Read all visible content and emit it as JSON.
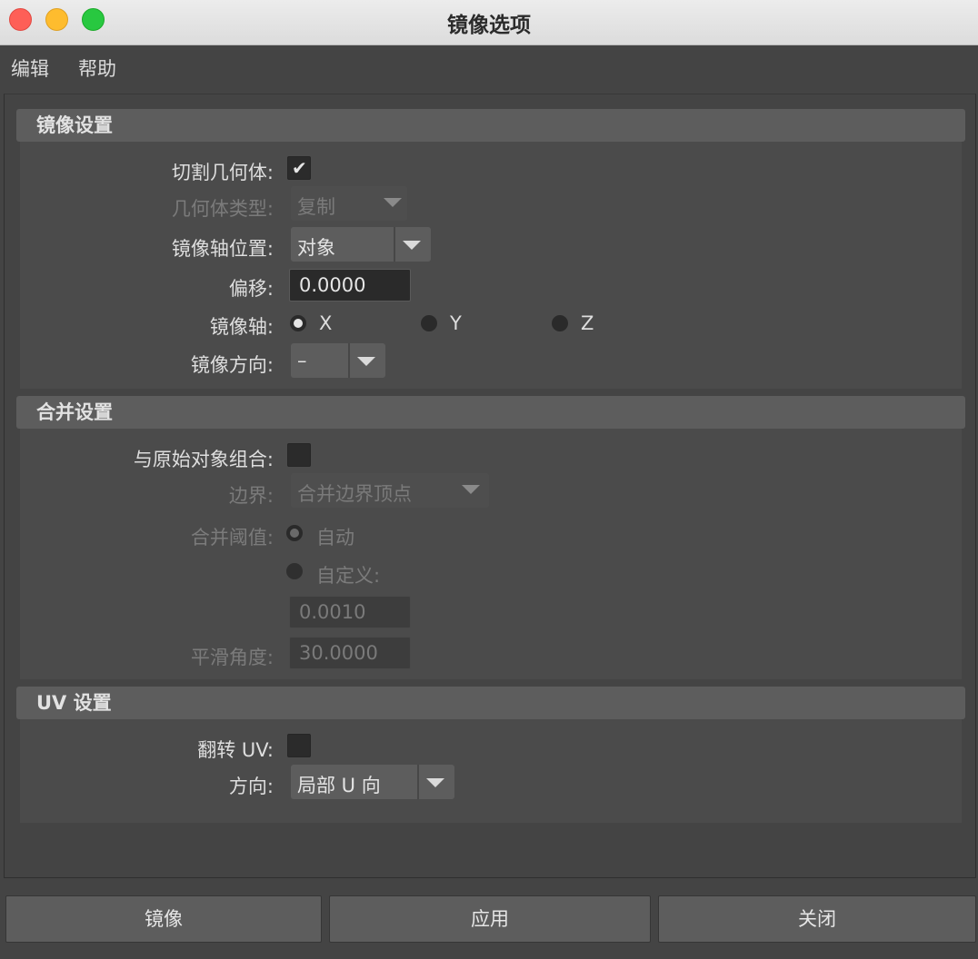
{
  "window": {
    "title": "镜像选项"
  },
  "menu": {
    "items": [
      "编辑",
      "帮助"
    ]
  },
  "sections": {
    "mirror": {
      "title": "镜像设置",
      "cut_geometry_label": "切割几何体:",
      "cut_geometry_checked": true,
      "geometry_type_label": "几何体类型:",
      "geometry_type_value": "复制",
      "axis_position_label": "镜像轴位置:",
      "axis_position_value": "对象",
      "offset_label": "偏移:",
      "offset_value": "0.0000",
      "axis_label": "镜像轴:",
      "axis_options": [
        "X",
        "Y",
        "Z"
      ],
      "axis_selected": "X",
      "direction_label": "镜像方向:",
      "direction_value": "–"
    },
    "merge": {
      "title": "合并设置",
      "combine_label": "与原始对象组合:",
      "combine_checked": false,
      "border_label": "边界:",
      "border_value": "合并边界顶点",
      "threshold_label": "合并阈值:",
      "threshold_auto": "自动",
      "threshold_custom": "自定义:",
      "threshold_selected": "自动",
      "threshold_value": "0.0010",
      "smooth_angle_label": "平滑角度:",
      "smooth_angle_value": "30.0000"
    },
    "uv": {
      "title": "UV 设置",
      "flip_uv_label": "翻转 UV:",
      "flip_uv_checked": false,
      "direction_label": "方向:",
      "direction_value": "局部 U 向"
    }
  },
  "buttons": {
    "mirror": "镜像",
    "apply": "应用",
    "close": "关闭"
  },
  "colors": {
    "background": "#444444",
    "section_header": "#5d5d5d",
    "field": "#2a2a2a"
  }
}
